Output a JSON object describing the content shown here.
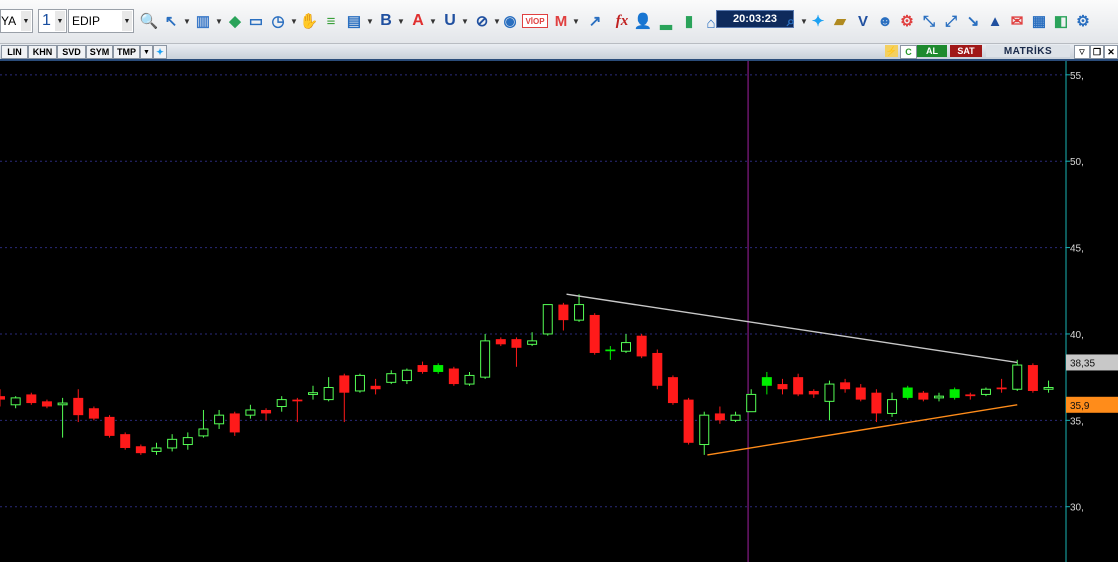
{
  "toolbar": {
    "left_partial": "YA",
    "period_value": "1",
    "symbol_value": "EDIP",
    "clock": "20:03:23",
    "bold_b": "B",
    "bold_a": "A",
    "bold_u": "U",
    "viop": "VİOP",
    "fx": "fx"
  },
  "tabs": {
    "lin": "LIN",
    "khn": "KHN",
    "svd": "SVD",
    "sym": "SYM",
    "tmp": "TMP",
    "buy": "AL",
    "sell": "SAT",
    "brand": "MATRİKS",
    "bolt": "⚡",
    "refresh": "C"
  },
  "colors": {
    "up": "#00ee00",
    "down": "#ff1a1a",
    "hollow_up": "#55ff55",
    "trend_upper": "#c8c8c8",
    "trend_lower": "#ff8c1a",
    "vline": "#a020a0",
    "axis": "#19b3b3"
  },
  "chart_data": {
    "type": "candlestick",
    "ylim": [
      26.8,
      55.8
    ],
    "yticks": [
      "55,",
      "50,",
      "45,",
      "40,",
      "35,",
      "30,"
    ],
    "ytick_values": [
      55,
      50,
      45,
      40,
      35,
      30
    ],
    "price_labels": [
      {
        "text": "38,35",
        "value": 38.35,
        "color": "#c8c8c8"
      },
      {
        "text": "35,9",
        "value": 35.9,
        "color": "#ff8c1a"
      }
    ],
    "candles": [
      {
        "o": 36.4,
        "h": 36.8,
        "l": 35.8,
        "c": 36.2,
        "col": "down"
      },
      {
        "o": 35.9,
        "h": 36.4,
        "l": 35.7,
        "c": 36.3,
        "col": "hollow"
      },
      {
        "o": 36.5,
        "h": 36.6,
        "l": 35.9,
        "c": 36.0,
        "col": "down"
      },
      {
        "o": 36.1,
        "h": 36.2,
        "l": 35.7,
        "c": 35.8,
        "col": "down"
      },
      {
        "o": 35.9,
        "h": 36.3,
        "l": 34.0,
        "c": 36.0,
        "col": "hollow"
      },
      {
        "o": 36.3,
        "h": 36.8,
        "l": 34.9,
        "c": 35.3,
        "col": "down"
      },
      {
        "o": 35.7,
        "h": 35.8,
        "l": 35.0,
        "c": 35.1,
        "col": "down"
      },
      {
        "o": 35.2,
        "h": 35.3,
        "l": 34.0,
        "c": 34.1,
        "col": "down"
      },
      {
        "o": 34.2,
        "h": 34.3,
        "l": 33.3,
        "c": 33.4,
        "col": "down"
      },
      {
        "o": 33.5,
        "h": 33.6,
        "l": 33.0,
        "c": 33.1,
        "col": "down"
      },
      {
        "o": 33.2,
        "h": 33.7,
        "l": 33.0,
        "c": 33.4,
        "col": "hollow"
      },
      {
        "o": 33.4,
        "h": 34.2,
        "l": 33.2,
        "c": 33.9,
        "col": "hollow"
      },
      {
        "o": 33.6,
        "h": 34.3,
        "l": 33.3,
        "c": 34.0,
        "col": "hollow"
      },
      {
        "o": 34.1,
        "h": 35.6,
        "l": 34.0,
        "c": 34.5,
        "col": "hollow"
      },
      {
        "o": 34.8,
        "h": 35.6,
        "l": 34.5,
        "c": 35.3,
        "col": "hollow"
      },
      {
        "o": 35.4,
        "h": 35.5,
        "l": 34.1,
        "c": 34.3,
        "col": "down"
      },
      {
        "o": 35.3,
        "h": 35.9,
        "l": 35.1,
        "c": 35.6,
        "col": "hollow"
      },
      {
        "o": 35.6,
        "h": 35.7,
        "l": 35.0,
        "c": 35.4,
        "col": "down"
      },
      {
        "o": 35.8,
        "h": 36.4,
        "l": 35.5,
        "c": 36.2,
        "col": "hollow"
      },
      {
        "o": 36.2,
        "h": 36.3,
        "l": 34.9,
        "c": 36.1,
        "col": "down"
      },
      {
        "o": 36.5,
        "h": 37.0,
        "l": 36.2,
        "c": 36.6,
        "col": "hollow"
      },
      {
        "o": 36.2,
        "h": 37.5,
        "l": 36.1,
        "c": 36.9,
        "col": "hollow"
      },
      {
        "o": 37.6,
        "h": 37.7,
        "l": 34.9,
        "c": 36.6,
        "col": "down"
      },
      {
        "o": 36.7,
        "h": 37.7,
        "l": 36.6,
        "c": 37.6,
        "col": "hollow"
      },
      {
        "o": 37.0,
        "h": 37.4,
        "l": 36.5,
        "c": 36.8,
        "col": "down"
      },
      {
        "o": 37.2,
        "h": 37.9,
        "l": 37.1,
        "c": 37.7,
        "col": "hollow"
      },
      {
        "o": 37.3,
        "h": 38.0,
        "l": 37.1,
        "c": 37.9,
        "col": "hollow"
      },
      {
        "o": 38.2,
        "h": 38.4,
        "l": 37.7,
        "c": 37.8,
        "col": "down"
      },
      {
        "o": 37.8,
        "h": 38.3,
        "l": 37.7,
        "c": 38.2,
        "col": "up"
      },
      {
        "o": 38.0,
        "h": 38.1,
        "l": 37.0,
        "c": 37.1,
        "col": "down"
      },
      {
        "o": 37.1,
        "h": 37.8,
        "l": 37.0,
        "c": 37.6,
        "col": "hollow"
      },
      {
        "o": 37.5,
        "h": 40.0,
        "l": 37.4,
        "c": 39.6,
        "col": "hollow"
      },
      {
        "o": 39.7,
        "h": 39.8,
        "l": 39.3,
        "c": 39.4,
        "col": "down"
      },
      {
        "o": 39.7,
        "h": 39.8,
        "l": 38.1,
        "c": 39.2,
        "col": "down"
      },
      {
        "o": 39.4,
        "h": 40.1,
        "l": 39.3,
        "c": 39.6,
        "col": "hollow"
      },
      {
        "o": 40.0,
        "h": 41.7,
        "l": 39.9,
        "c": 41.7,
        "col": "hollow"
      },
      {
        "o": 41.7,
        "h": 41.8,
        "l": 40.2,
        "c": 40.8,
        "col": "down"
      },
      {
        "o": 40.8,
        "h": 42.3,
        "l": 40.7,
        "c": 41.7,
        "col": "hollow"
      },
      {
        "o": 41.1,
        "h": 41.2,
        "l": 38.8,
        "c": 38.9,
        "col": "down"
      },
      {
        "o": 39.0,
        "h": 39.3,
        "l": 38.5,
        "c": 39.1,
        "col": "up"
      },
      {
        "o": 39.0,
        "h": 40.0,
        "l": 38.9,
        "c": 39.5,
        "col": "hollow"
      },
      {
        "o": 39.9,
        "h": 40.0,
        "l": 38.6,
        "c": 38.7,
        "col": "down"
      },
      {
        "o": 38.9,
        "h": 39.1,
        "l": 36.8,
        "c": 37.0,
        "col": "down"
      },
      {
        "o": 37.5,
        "h": 37.6,
        "l": 35.9,
        "c": 36.0,
        "col": "down"
      },
      {
        "o": 36.2,
        "h": 36.3,
        "l": 33.6,
        "c": 33.7,
        "col": "down"
      },
      {
        "o": 33.6,
        "h": 35.5,
        "l": 33.0,
        "c": 35.3,
        "col": "hollow"
      },
      {
        "o": 35.4,
        "h": 35.8,
        "l": 34.8,
        "c": 35.0,
        "col": "down"
      },
      {
        "o": 35.0,
        "h": 35.5,
        "l": 34.9,
        "c": 35.3,
        "col": "hollow"
      },
      {
        "o": 35.5,
        "h": 36.8,
        "l": 35.5,
        "c": 36.5,
        "col": "hollow"
      },
      {
        "o": 37.0,
        "h": 37.8,
        "l": 36.5,
        "c": 37.5,
        "col": "up"
      },
      {
        "o": 37.1,
        "h": 37.4,
        "l": 36.5,
        "c": 36.8,
        "col": "down"
      },
      {
        "o": 37.5,
        "h": 37.7,
        "l": 36.4,
        "c": 36.5,
        "col": "down"
      },
      {
        "o": 36.7,
        "h": 36.8,
        "l": 36.3,
        "c": 36.5,
        "col": "down"
      },
      {
        "o": 36.1,
        "h": 37.3,
        "l": 35.0,
        "c": 37.1,
        "col": "hollow"
      },
      {
        "o": 37.2,
        "h": 37.4,
        "l": 36.6,
        "c": 36.8,
        "col": "down"
      },
      {
        "o": 36.9,
        "h": 37.1,
        "l": 36.1,
        "c": 36.2,
        "col": "down"
      },
      {
        "o": 36.6,
        "h": 36.8,
        "l": 34.9,
        "c": 35.4,
        "col": "down"
      },
      {
        "o": 35.4,
        "h": 36.6,
        "l": 35.2,
        "c": 36.2,
        "col": "hollow"
      },
      {
        "o": 36.3,
        "h": 37.0,
        "l": 36.2,
        "c": 36.9,
        "col": "up"
      },
      {
        "o": 36.6,
        "h": 36.7,
        "l": 36.1,
        "c": 36.2,
        "col": "down"
      },
      {
        "o": 36.3,
        "h": 36.6,
        "l": 36.1,
        "c": 36.4,
        "col": "hollow"
      },
      {
        "o": 36.3,
        "h": 36.9,
        "l": 36.2,
        "c": 36.8,
        "col": "up"
      },
      {
        "o": 36.4,
        "h": 36.6,
        "l": 36.2,
        "c": 36.5,
        "col": "down"
      },
      {
        "o": 36.5,
        "h": 36.9,
        "l": 36.4,
        "c": 36.8,
        "col": "hollow"
      },
      {
        "o": 36.9,
        "h": 37.4,
        "l": 36.6,
        "c": 36.8,
        "col": "down"
      },
      {
        "o": 36.8,
        "h": 38.5,
        "l": 36.7,
        "c": 38.2,
        "col": "hollow"
      },
      {
        "o": 38.2,
        "h": 38.3,
        "l": 36.6,
        "c": 36.7,
        "col": "down"
      },
      {
        "o": 36.8,
        "h": 37.3,
        "l": 36.6,
        "c": 36.9,
        "col": "hollow"
      }
    ],
    "trendlines": [
      {
        "name": "upper",
        "x1": 36.2,
        "y1": 42.3,
        "x2": 65.0,
        "y2": 38.35,
        "color": "#c8c8c8"
      },
      {
        "name": "lower",
        "x1": 45.2,
        "y1": 33.0,
        "x2": 65.0,
        "y2": 35.9,
        "color": "#ff8c1a"
      }
    ],
    "vline_x": 47.8
  }
}
